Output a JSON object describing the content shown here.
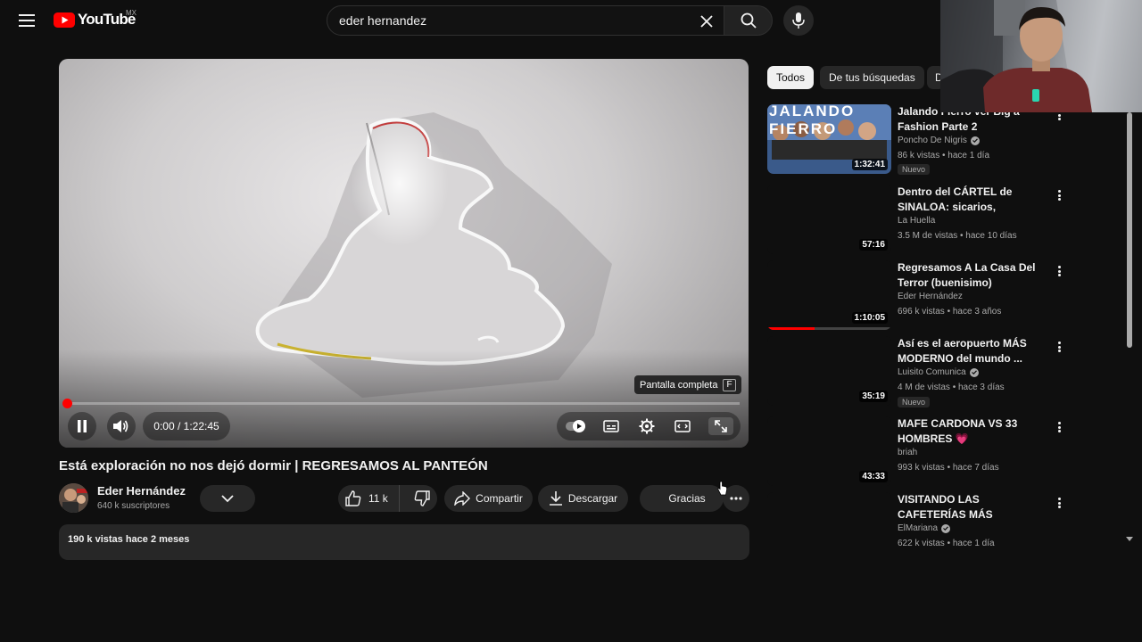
{
  "header": {
    "logo_text": "YouTube",
    "country_code": "MX",
    "search_value": "eder hernandez"
  },
  "player": {
    "fullscreen_tooltip": "Pantalla completa",
    "fullscreen_key": "F",
    "time_display": "0:00 / 1:22:45",
    "progress_fraction": 0
  },
  "video": {
    "title": "Está exploración no nos dejó dormir | REGRESAMOS AL PANTEÓN",
    "channel_name": "Eder Hernández",
    "channel_subs": "640 k suscriptores",
    "like_count": "11 k",
    "share_label": "Compartir",
    "download_label": "Descargar",
    "thanks_label": "Gracias",
    "description_meta": "190 k vistas  hace 2 meses"
  },
  "chips": [
    {
      "label": "Todos",
      "active": true
    },
    {
      "label": "De tus búsquedas",
      "active": false
    },
    {
      "label": "D",
      "active": false
    }
  ],
  "recommendations": [
    {
      "title": "Jalando Fierro ver Big a Fashion Parte 2",
      "channel": "Poncho De Nigris",
      "verified": true,
      "meta": "86 k vistas • hace 1 día",
      "duration": "1:32:41",
      "badge": "Nuevo",
      "thumb_text": "JALANDO FIERRO",
      "progress": 0
    },
    {
      "title": "Dentro del CÁRTEL de SINALOA: sicarios, laboratorio...",
      "channel": "La Huella",
      "verified": false,
      "meta": "3.5 M de vistas • hace 10 días",
      "duration": "57:16",
      "badge": "",
      "progress": 0
    },
    {
      "title": "Regresamos A La Casa Del Terror (buenisimo)",
      "channel": "Eder Hernández",
      "verified": false,
      "meta": "696 k vistas • hace 3 años",
      "duration": "1:10:05",
      "badge": "",
      "progress": 0.38
    },
    {
      "title": "Así es el aeropuerto MÁS MODERNO del mundo ...",
      "channel": "Luisito Comunica",
      "verified": true,
      "meta": "4 M de vistas • hace 3 días",
      "duration": "35:19",
      "badge": "Nuevo",
      "progress": 0
    },
    {
      "title": "MAFE CARDONA VS 33 HOMBRES 💗",
      "channel": "briah",
      "verified": false,
      "meta": "993 k vistas • hace 7 días",
      "duration": "43:33",
      "badge": "",
      "progress": 0
    },
    {
      "title": "VISITANDO LAS CAFETERÍAS MÁS EXTRAÑAS DE MÉXICO ...",
      "channel": "ElMariana",
      "verified": true,
      "meta": "622 k vistas • hace 1 día",
      "duration": "",
      "badge": "",
      "progress": 0
    }
  ],
  "colors": {
    "background": "#0f0f0f",
    "accent_red": "#ff0000",
    "pill_bg": "#272727",
    "text_primary": "#f1f1f1",
    "text_secondary": "#aaaaaa"
  },
  "icons": [
    "menu-icon",
    "youtube-logo-icon",
    "close-icon",
    "search-icon",
    "mic-icon",
    "pause-icon",
    "volume-icon",
    "autoplay-toggle-icon",
    "subtitles-icon",
    "settings-gear-icon",
    "theater-mode-icon",
    "fullscreen-icon",
    "thumbs-up-icon",
    "thumbs-down-icon",
    "share-icon",
    "download-icon",
    "more-horizontal-icon",
    "chevron-down-icon",
    "verified-icon",
    "more-vertical-icon"
  ]
}
